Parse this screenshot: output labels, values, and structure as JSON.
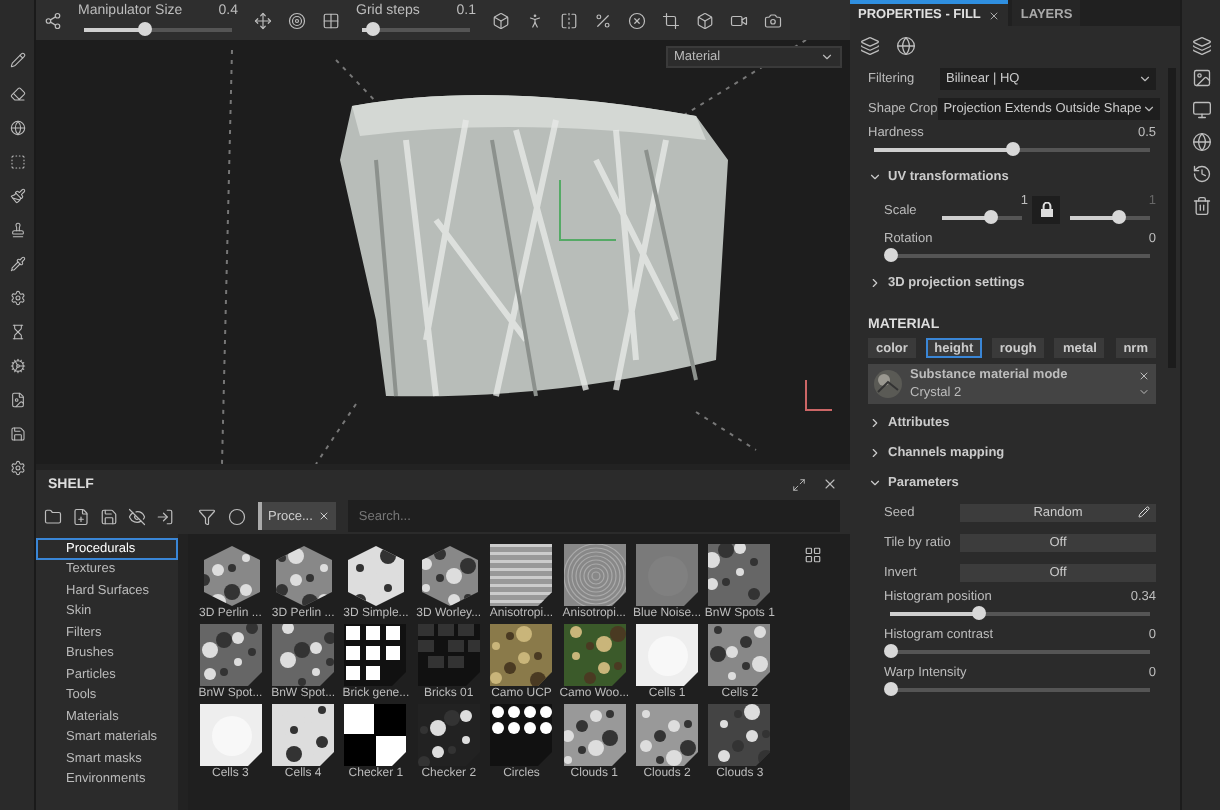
{
  "toolbar": {
    "sliders": [
      {
        "label": "Manipulator Size",
        "value": "0.4",
        "level": 0.4
      },
      {
        "label": "Grid steps",
        "value": "0.1",
        "level": 0.1
      }
    ]
  },
  "viewport": {
    "mode": "Material"
  },
  "panel_tabs": [
    {
      "label": "PROPERTIES - FILL",
      "selected": true
    },
    {
      "label": "LAYERS",
      "selected": false
    }
  ],
  "properties": {
    "rows": [
      {
        "kind": "select",
        "label": "Filtering",
        "value": "Bilinear | HQ"
      },
      {
        "kind": "select",
        "label": "Shape Crop",
        "value": "Projection Extends Outside Shape"
      },
      {
        "kind": "slider",
        "label": "Hardness",
        "value": "0.5",
        "level": 0.5
      }
    ],
    "uv": {
      "label": "UV transformations",
      "expanded": true,
      "scale": {
        "label": "Scale",
        "sliders": [
          {
            "value": "1",
            "level": 0.6
          },
          {
            "value": "1",
            "level": 0.6
          }
        ]
      },
      "rotation": {
        "label": "Rotation",
        "value": "0",
        "level": 0
      }
    },
    "projection": {
      "label": "3D projection settings",
      "expanded": false
    }
  },
  "material": {
    "title": "MATERIAL",
    "channels": [
      {
        "label": "color",
        "selected": false
      },
      {
        "label": "height",
        "selected": true
      },
      {
        "label": "rough",
        "selected": false
      },
      {
        "label": "metal",
        "selected": false
      },
      {
        "label": "nrm",
        "selected": false
      }
    ],
    "substance": {
      "title": "Substance material mode",
      "name": "Crystal 2"
    },
    "sections": [
      {
        "label": "Attributes",
        "expanded": false
      },
      {
        "label": "Channels mapping",
        "expanded": false
      },
      {
        "label": "Parameters",
        "expanded": true
      }
    ],
    "parameters": [
      {
        "kind": "button",
        "label": "Seed",
        "value": "Random"
      },
      {
        "kind": "toggle",
        "label": "Tile by ratio",
        "value": "Off"
      },
      {
        "kind": "toggle",
        "label": "Invert",
        "value": "Off"
      },
      {
        "kind": "slider",
        "label": "Histogram position",
        "value": "0.34",
        "level": 0.34
      },
      {
        "kind": "slider",
        "label": "Histogram contrast",
        "value": "0",
        "level": 0
      },
      {
        "kind": "slider",
        "label": "Warp Intensity",
        "value": "0",
        "level": 0
      }
    ]
  },
  "shelf": {
    "title": "SHELF",
    "filter_tag": "Proce...",
    "search": {
      "placeholder": "Search..."
    },
    "categories": [
      {
        "label": "Procedurals",
        "selected": true
      },
      {
        "label": "Textures",
        "selected": false
      },
      {
        "label": "Hard Surfaces",
        "selected": false
      },
      {
        "label": "Skin",
        "selected": false
      },
      {
        "label": "Filters",
        "selected": false
      },
      {
        "label": "Brushes",
        "selected": false
      },
      {
        "label": "Particles",
        "selected": false
      },
      {
        "label": "Tools",
        "selected": false
      },
      {
        "label": "Materials",
        "selected": false
      },
      {
        "label": "Smart materials",
        "selected": false
      },
      {
        "label": "Smart masks",
        "selected": false
      },
      {
        "label": "Environments",
        "selected": false
      }
    ],
    "items": [
      {
        "label": "3D Perlin ...",
        "kind": "hex"
      },
      {
        "label": "3D Perlin ...",
        "kind": "hex"
      },
      {
        "label": "3D Simple...",
        "kind": "hex"
      },
      {
        "label": "3D Worley...",
        "kind": "hex"
      },
      {
        "label": "Anisotropi...",
        "kind": "square"
      },
      {
        "label": "Anisotropi...",
        "kind": "square"
      },
      {
        "label": "Blue Noise...",
        "kind": "square"
      },
      {
        "label": "BnW Spots 1",
        "kind": "square"
      },
      {
        "label": "BnW Spot...",
        "kind": "square"
      },
      {
        "label": "BnW Spot...",
        "kind": "square"
      },
      {
        "label": "Brick gene...",
        "kind": "square"
      },
      {
        "label": "Bricks 01",
        "kind": "square"
      },
      {
        "label": "Camo UCP",
        "kind": "square"
      },
      {
        "label": "Camo Woo...",
        "kind": "square"
      },
      {
        "label": "Cells 1",
        "kind": "square"
      },
      {
        "label": "Cells 2",
        "kind": "square"
      },
      {
        "label": "Cells 3",
        "kind": "square"
      },
      {
        "label": "Cells 4",
        "kind": "square"
      },
      {
        "label": "Checker 1",
        "kind": "square"
      },
      {
        "label": "Checker 2",
        "kind": "square"
      },
      {
        "label": "Circles",
        "kind": "square"
      },
      {
        "label": "Clouds 1",
        "kind": "square"
      },
      {
        "label": "Clouds 2",
        "kind": "square"
      },
      {
        "label": "Clouds 3",
        "kind": "square"
      }
    ]
  }
}
